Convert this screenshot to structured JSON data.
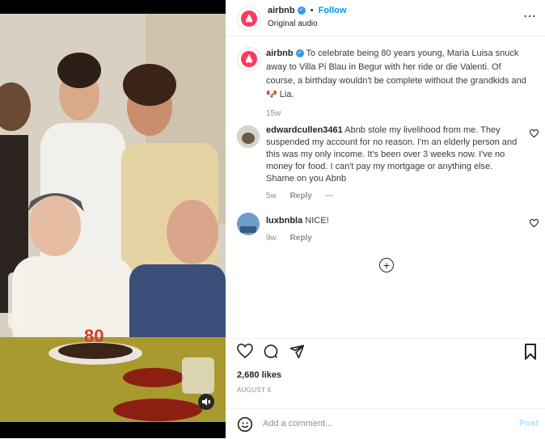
{
  "header": {
    "username": "airbnb",
    "follow_label": "Follow",
    "separator": "•",
    "subtitle": "Original audio",
    "more_icon": "⋯"
  },
  "caption": {
    "username": "airbnb",
    "text": "To celebrate being 80 years young, Maria Luisa snuck away to Villa Pi Blau in Begur with her ride or die Valenti. Of course, a birthday wouldn't be complete without the grandkids and 🐶 Lia.",
    "age": "15w"
  },
  "comments": [
    {
      "username": "edwardcullen3461",
      "text": "Abnb stole my livelihood from me. They suspended my account for no reason. I'm an elderly person and this was my only income. It's been over 3 weeks now. I've no money for food. I can't pay my mortgage or anything else. Shame on you Abnb",
      "age": "5w",
      "reply_label": "Reply",
      "more": "···"
    },
    {
      "username": "luxbnbla",
      "text": "NICE!",
      "age": "9w",
      "reply_label": "Reply"
    }
  ],
  "load_more_icon": "+",
  "likes": "2,680 likes",
  "date": "AUGUST 6",
  "add_comment": {
    "placeholder": "Add a comment...",
    "post_label": "Post"
  },
  "media": {
    "cake_number": "80"
  },
  "icons": {
    "heart": "heart-icon",
    "comment": "comment-icon",
    "share": "share-icon",
    "bookmark": "bookmark-icon",
    "emoji": "emoji-icon",
    "mute": "mute-icon"
  },
  "colors": {
    "accent": "#0095f6",
    "verified": "#3897f0",
    "muted_text": "#8e8e8e",
    "post_disabled": "#b2dffc"
  }
}
